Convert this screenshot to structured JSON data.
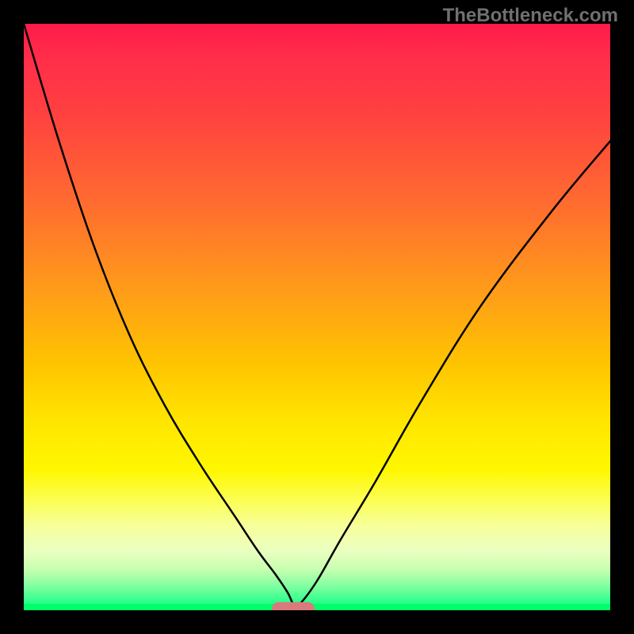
{
  "watermark": "TheBottleneck.com",
  "chart_data": {
    "type": "line",
    "title": "",
    "xlabel": "",
    "ylabel": "",
    "xlim": [
      0,
      100
    ],
    "ylim": [
      0,
      100
    ],
    "grid": false,
    "series": [
      {
        "name": "curve",
        "x": [
          0,
          6,
          12,
          18,
          24,
          30,
          36,
          40,
          43,
          45,
          46,
          47,
          50,
          54,
          60,
          68,
          78,
          90,
          100
        ],
        "values": [
          100,
          80,
          62,
          47,
          35,
          25,
          16,
          10,
          6,
          3,
          1,
          1,
          5,
          12,
          22,
          36,
          52,
          68,
          80
        ]
      }
    ],
    "optimum_x": 46,
    "background_gradient": {
      "top": "#ff1b4a",
      "middle": "#ffe600",
      "bottom": "#00ff80"
    },
    "marker_color": "#d97a7d"
  }
}
